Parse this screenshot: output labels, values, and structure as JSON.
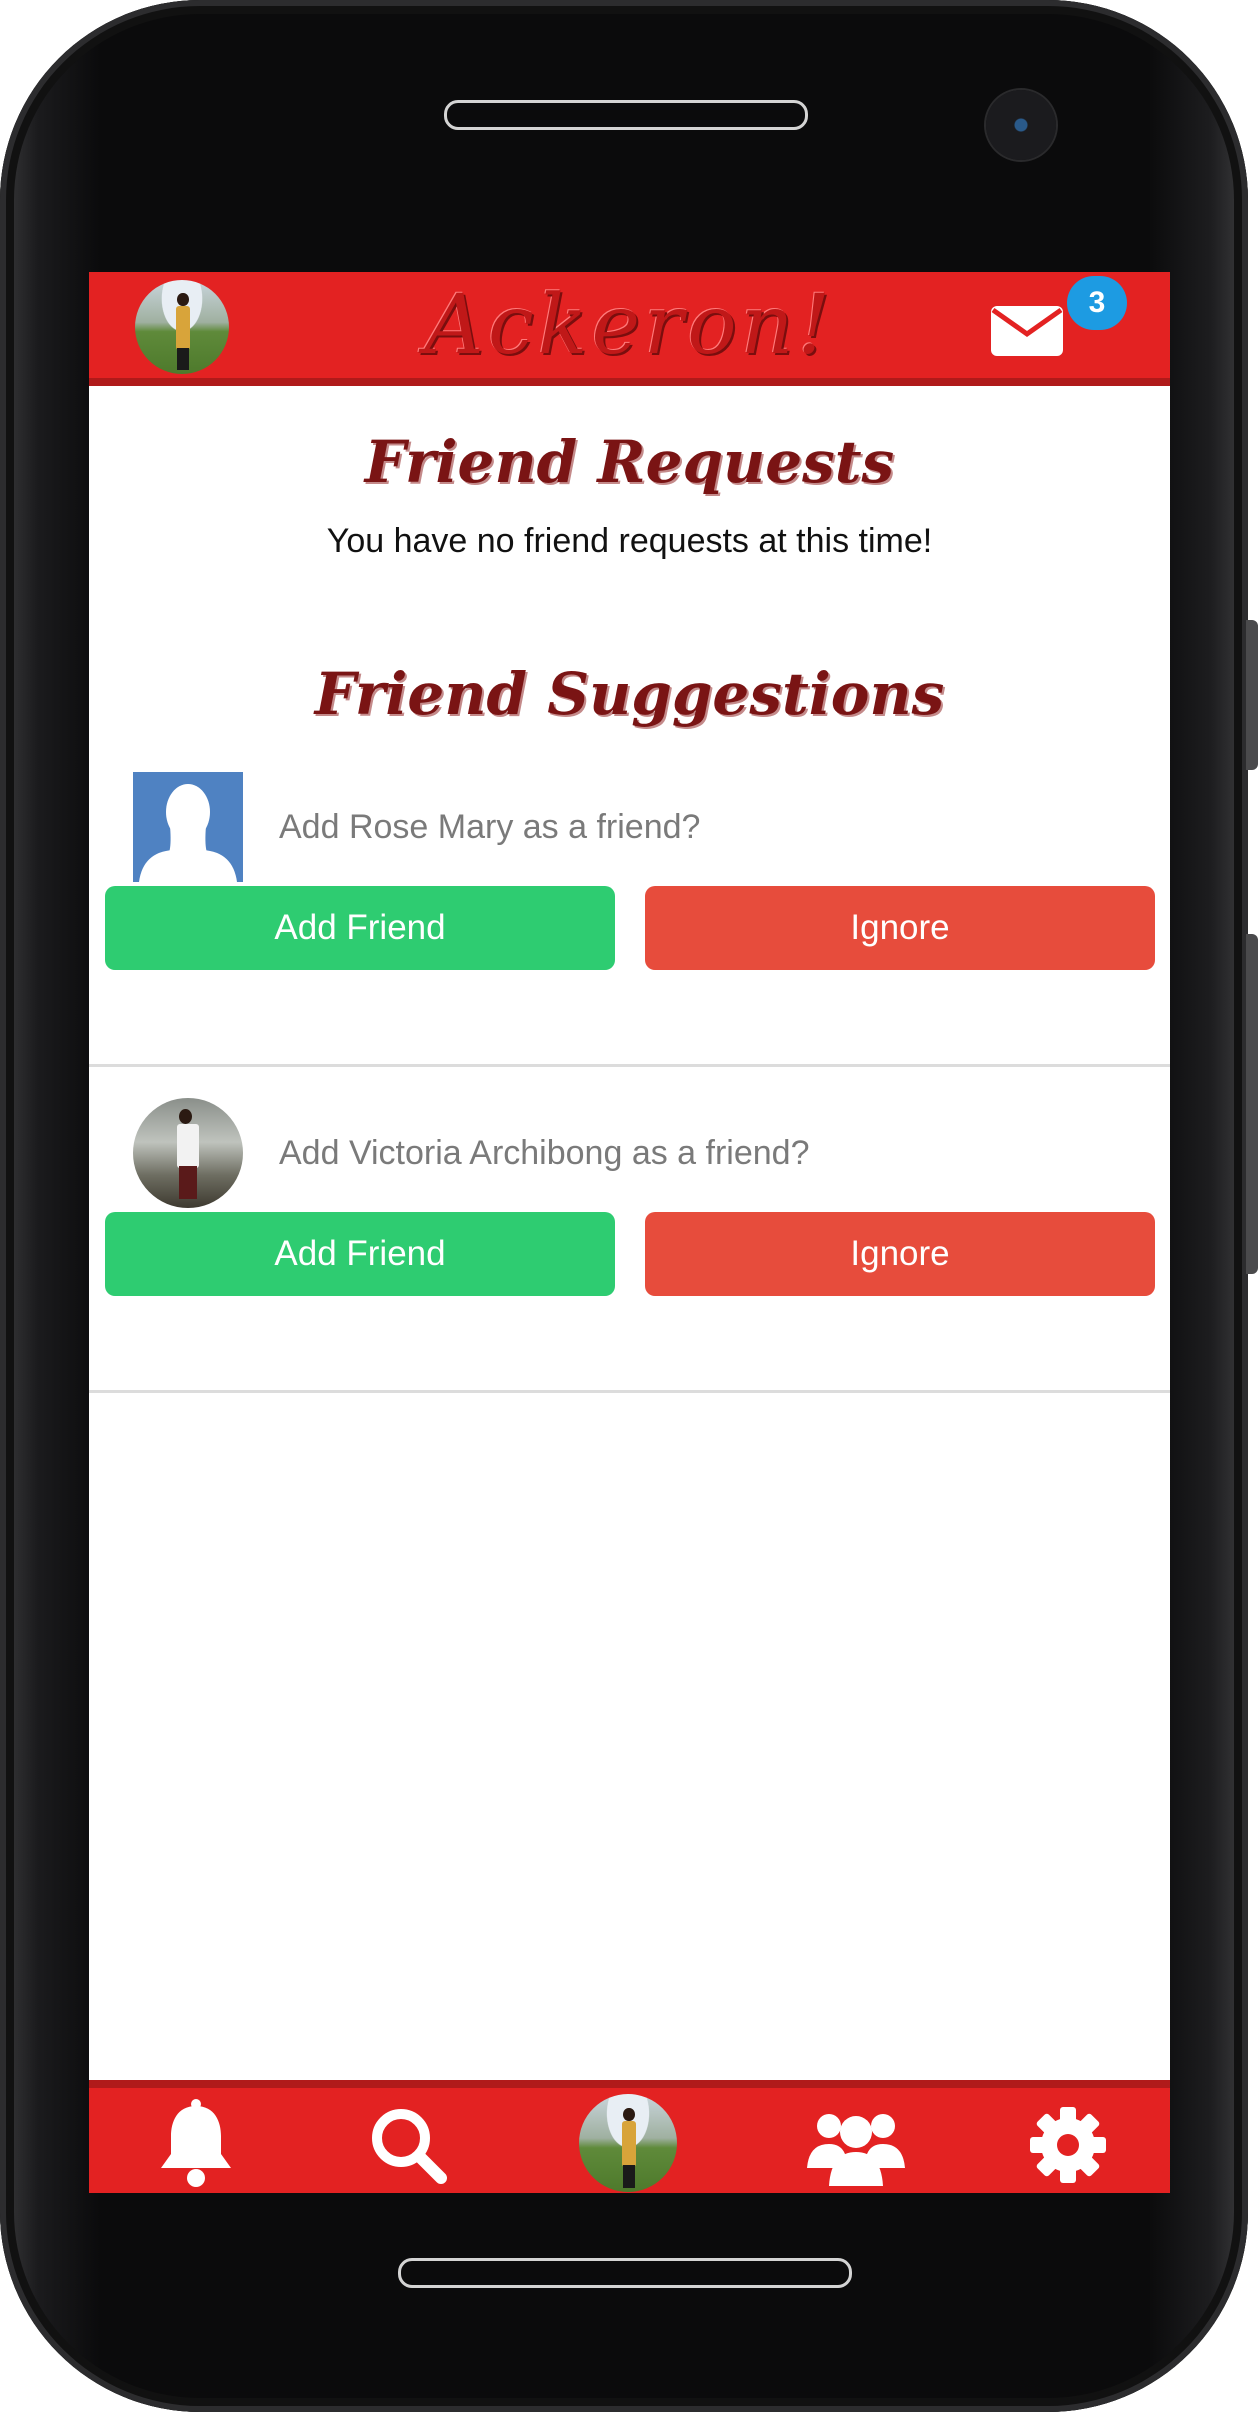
{
  "app": {
    "title": "Ackeron!",
    "mail_badge_count": "3",
    "accent_color": "#e32222",
    "header_icons": [
      "profile-avatar",
      "mail-icon"
    ]
  },
  "friend_requests": {
    "title": "Friend Requests",
    "empty_message": "You have no friend requests at this time!"
  },
  "friend_suggestions": {
    "title": "Friend Suggestions",
    "items": [
      {
        "prompt": "Add Rose Mary as a friend?",
        "add_label": "Add Friend",
        "ignore_label": "Ignore"
      },
      {
        "prompt": "Add Victoria Archibong as a friend?",
        "add_label": "Add Friend",
        "ignore_label": "Ignore"
      }
    ]
  },
  "bottom_nav": {
    "icons": [
      "bell-icon",
      "search-icon",
      "profile-avatar",
      "users-icon",
      "gear-icon"
    ]
  },
  "colors": {
    "add_button": "#2ecc71",
    "ignore_button": "#e74c3c",
    "badge": "#1d9be2"
  }
}
